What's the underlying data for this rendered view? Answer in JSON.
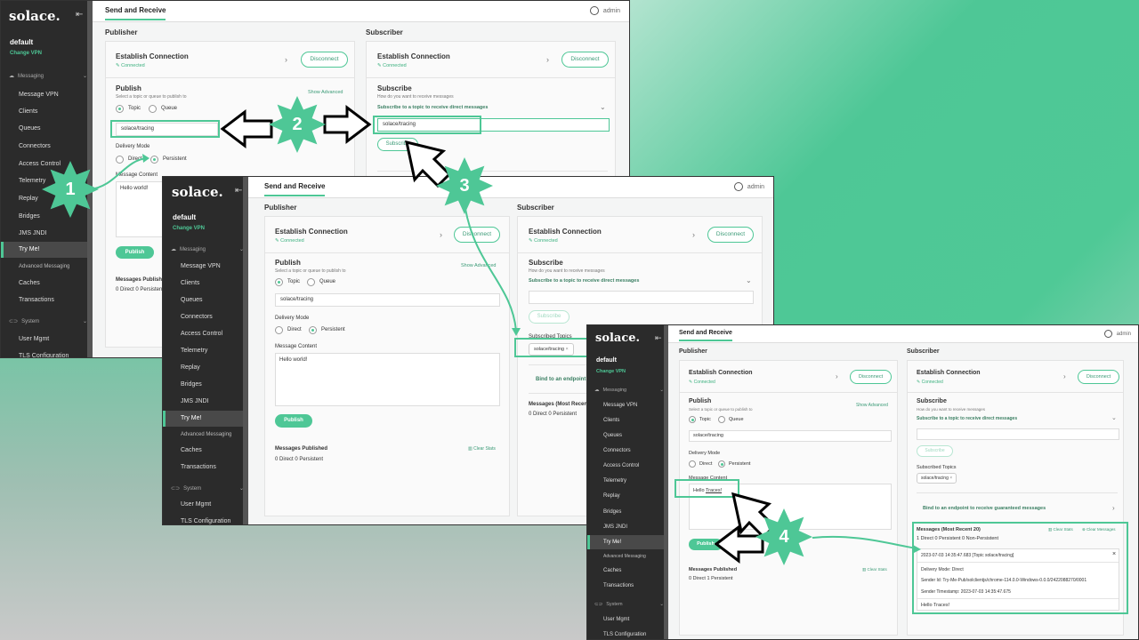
{
  "colors": {
    "accent": "#4ec796",
    "sidebar": "#2b2b2b"
  },
  "common": {
    "logo": "solace.",
    "vpn": "default",
    "change_vpn": "Change VPN",
    "tab": "Send and Receive",
    "user": "admin",
    "publisher": "Publisher",
    "subscriber": "Subscriber",
    "establish": "Establish Connection",
    "connected": "✎ Connected",
    "disconnect": "Disconnect",
    "publish_heading": "Publish",
    "publish_hint": "Select a topic or queue to publish to",
    "show_advanced": "Show Advanced",
    "topic": "Topic",
    "queue": "Queue",
    "delivery_mode": "Delivery Mode",
    "direct": "Direct",
    "persistent": "Persistent",
    "message_content": "Message Content",
    "publish_btn": "Publish",
    "messages_published": "Messages Published",
    "clear_stats": "Clear Stats",
    "subscribe_heading": "Subscribe",
    "subscribe_hint": "How do you want to receive messages",
    "subscribe_direct": "Subscribe to a topic to receive direct messages",
    "subscribe_btn": "Subscribe",
    "subscribed_topics": "Subscribed Topics",
    "bind_endpoint": "Bind to an endpoint to receive guaranteed messages",
    "topic_value": "solace/tracing",
    "nav": {
      "messaging": "Messaging",
      "message_vpn": "Message VPN",
      "clients": "Clients",
      "queues": "Queues",
      "connectors": "Connectors",
      "access_control": "Access Control",
      "telemetry": "Telemetry",
      "replay": "Replay",
      "bridges": "Bridges",
      "jms_jndi": "JMS JNDI",
      "try_me": "Try Me!",
      "advanced_messaging": "Advanced Messaging",
      "caches": "Caches",
      "transactions": "Transactions",
      "system": "System",
      "user_mgmt": "User Mgmt",
      "tls": "TLS Configuration"
    }
  },
  "shot1": {
    "message": "Hello world!",
    "published_counts": "0 Direct   0 Persistent"
  },
  "shot2": {
    "message": "Hello world!",
    "published_counts": "0 Direct     0 Persistent",
    "received_heading": "Messages  (Most Recent 20)",
    "received_counts": "0 Direct    0 Persistent"
  },
  "shot3": {
    "message_prefix": "Hello ",
    "message_link": "Traces!",
    "published_counts": "0 Direct    1 Persistent",
    "received_heading": "Messages  (Most Recent 20)",
    "received_counts": "1 Direct     0 Persistent     0 Non-Persistent",
    "clear_messages": "Clear Messages",
    "msg_header": "2023-07-03 14:35:47.683 [Topic solace/tracing]",
    "delivery_line": "Delivery Mode:   Direct",
    "sender_id": "Sender Id:   Try-Me-Pub/solclientjs/chrome-114.0.0-Windows-0.0.0/2422088270/0001",
    "sender_ts": "Sender Timestamp:   2023-07-03 14:35:47.675",
    "payload": "Hello Traces!"
  },
  "steps": [
    "1",
    "2",
    "3",
    "4"
  ]
}
